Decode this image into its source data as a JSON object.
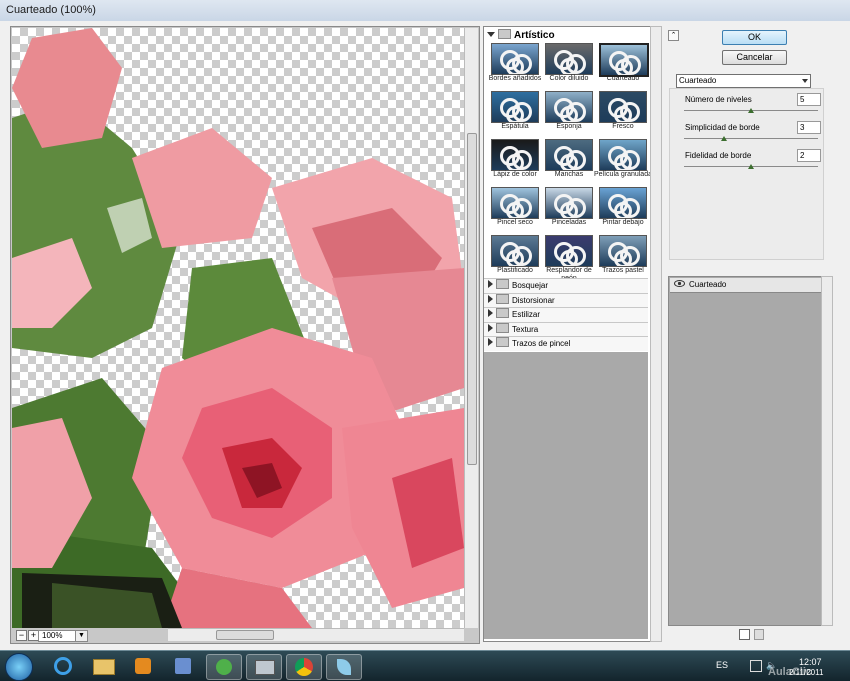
{
  "window": {
    "title": "Cuarteado (100%)"
  },
  "preview": {
    "zoom": "100%",
    "zoom_out": "−",
    "zoom_in": "+"
  },
  "gallery": {
    "category": "Artístico",
    "filters": [
      {
        "label": "Bordes añadidos"
      },
      {
        "label": "Color diluido"
      },
      {
        "label": "Cuarteado",
        "selected": true
      },
      {
        "label": "Espátula"
      },
      {
        "label": "Esponja"
      },
      {
        "label": "Fresco"
      },
      {
        "label": "Lápiz de color"
      },
      {
        "label": "Manchas"
      },
      {
        "label": "Película granulada"
      },
      {
        "label": "Pincel seco"
      },
      {
        "label": "Pinceladas"
      },
      {
        "label": "Pintar debajo"
      },
      {
        "label": "Plastificado"
      },
      {
        "label": "Resplandor de neón"
      },
      {
        "label": "Trazos pastel"
      }
    ],
    "categories": [
      "Bosquejar",
      "Distorsionar",
      "Estilizar",
      "Textura",
      "Trazos de pincel"
    ]
  },
  "buttons": {
    "ok": "OK",
    "cancel": "Cancelar"
  },
  "settings": {
    "filter": "Cuarteado",
    "params": [
      {
        "label": "Número de niveles",
        "value": "5",
        "level": 0.5
      },
      {
        "label": "Simplicidad de borde",
        "value": "3",
        "level": 0.3
      },
      {
        "label": "Fidelidad de borde",
        "value": "2",
        "level": 0.5
      }
    ]
  },
  "layers": {
    "items": [
      "Cuarteado"
    ]
  },
  "taskbar": {
    "language": "ES",
    "time": "12:07",
    "date": "2/11/2011",
    "watermark": "AulaClic"
  }
}
